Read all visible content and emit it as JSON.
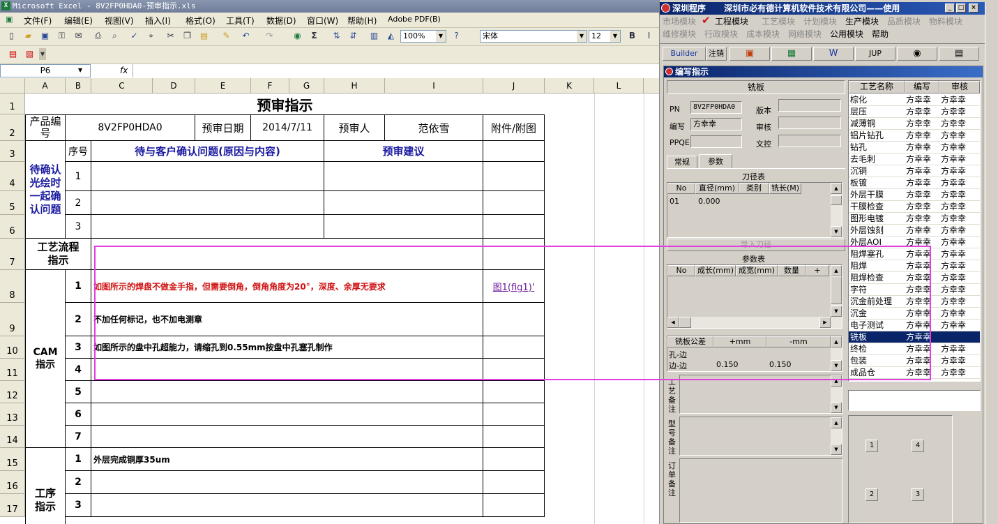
{
  "excel": {
    "title": "Microsoft Excel - 8V2FP0HDA0-预审指示.xls",
    "menu": [
      "文件(F)",
      "编辑(E)",
      "视图(V)",
      "插入(I)",
      "格式(O)",
      "工具(T)",
      "数据(D)",
      "窗口(W)",
      "帮助(H)",
      "Adobe PDF(B)"
    ],
    "zoom": "100%",
    "font_name": "宋体",
    "font_size": "12",
    "bold_label": "B",
    "name_box": "P6",
    "fx_label": "fx",
    "columns": [
      "A",
      "B",
      "C",
      "D",
      "E",
      "F",
      "G",
      "H",
      "I",
      "J",
      "K",
      "L"
    ],
    "rows": [
      "1",
      "2",
      "3",
      "4",
      "5",
      "6",
      "7",
      "8",
      "9",
      "10",
      "11",
      "12",
      "13",
      "14",
      "15",
      "16",
      "17"
    ],
    "sheet": {
      "title": "预审指示",
      "product_label": "产品编号",
      "product_no": "8V2FP0HDA0",
      "date_label": "预审日期",
      "date": "2014/7/11",
      "reviewer_label": "预审人",
      "reviewer": "范依雪",
      "attach_label": "附件/附图",
      "seq_label": "序号",
      "issue_header": "待与客户确认问题(原因与内容)",
      "suggest_header": "预审建议",
      "pending_label": "待确认光绘时一起确认问题",
      "pending_nums": [
        "1",
        "2",
        "3"
      ],
      "flow_label": "工艺流程指示",
      "cam_label": "CAM指示",
      "cam_nums": [
        "1",
        "2",
        "3",
        "4",
        "5",
        "6",
        "7"
      ],
      "cam_items": [
        "如图所示的焊盘不做金手指，但需要倒角，倒角角度为20°，深度、余厚无要求",
        "不加任何标记，也不加电测章",
        "如图所示的盘中孔超能力，请缩孔到0.55mm按盘中孔塞孔制作"
      ],
      "cam_link": "图1(fig1)'",
      "process_label": "工序指示",
      "process_nums": [
        "1",
        "2",
        "3"
      ],
      "process_items": [
        "外层完成铜厚35um"
      ]
    }
  },
  "app": {
    "title": "深圳程序",
    "company": "深圳市必有德计算机软件技术有限公司——使用",
    "win_buttons": [
      "_",
      "□",
      "×"
    ],
    "menu_row1": [
      "市场模块",
      "工程模块",
      "工艺模块",
      "计划模块",
      "生产模块",
      "品质模块",
      "物料模块"
    ],
    "menu_row2": [
      "维修模块",
      "行政模块",
      "成本模块",
      "网络模块",
      "公用模块",
      "帮助"
    ],
    "toolbar": [
      "Builder",
      "注销",
      "JUP"
    ],
    "sub": {
      "title": "编写指示",
      "section": "铣板",
      "pn_label": "PN",
      "pn_value": "8V2FP0HDA0",
      "version_label": "版本",
      "writer_label": "编写",
      "writer_value": "方幸幸",
      "audit_label": "审核",
      "ppqe_label": "PPQE",
      "doc_label": "文控",
      "tabs": [
        "常规",
        "参数"
      ],
      "tool_table_title": "刀径表",
      "tool_cols": [
        "No",
        "直径(mm)",
        "类别",
        "铣长(M)"
      ],
      "tool_rows": [
        [
          "01",
          "0.000",
          "",
          ""
        ]
      ],
      "import_button": "导入刀径",
      "param_title": "参数表",
      "param_cols": [
        "No",
        "成长(mm)",
        "成宽(mm)",
        "数量",
        "+"
      ],
      "tol_cols": [
        "铣板公差",
        "+mm",
        "-mm"
      ],
      "tol_rows": [
        [
          "孔-边",
          "",
          ""
        ],
        [
          "边-边",
          "0.150",
          "0.150"
        ]
      ],
      "note1": "工艺备注",
      "note2": "型号备注",
      "note3": "订单备注",
      "proc_cols": [
        "工艺名称",
        "编写",
        "审核"
      ],
      "processes": [
        [
          "棕化",
          "方幸幸",
          "方幸幸"
        ],
        [
          "层压",
          "方幸幸",
          "方幸幸"
        ],
        [
          "减薄铜",
          "方幸幸",
          "方幸幸"
        ],
        [
          "铝片钻孔",
          "方幸幸",
          "方幸幸"
        ],
        [
          "钻孔",
          "方幸幸",
          "方幸幸"
        ],
        [
          "去毛刺",
          "方幸幸",
          "方幸幸"
        ],
        [
          "沉铜",
          "方幸幸",
          "方幸幸"
        ],
        [
          "板镀",
          "方幸幸",
          "方幸幸"
        ],
        [
          "外层干膜",
          "方幸幸",
          "方幸幸"
        ],
        [
          "干膜检查",
          "方幸幸",
          "方幸幸"
        ],
        [
          "图形电镀",
          "方幸幸",
          "方幸幸"
        ],
        [
          "外层蚀刻",
          "方幸幸",
          "方幸幸"
        ],
        [
          "外层AOI",
          "方幸幸",
          "方幸幸"
        ],
        [
          "阻焊塞孔",
          "方幸幸",
          "方幸幸"
        ],
        [
          "阻焊",
          "方幸幸",
          "方幸幸"
        ],
        [
          "阻焊检查",
          "方幸幸",
          "方幸幸"
        ],
        [
          "字符",
          "方幸幸",
          "方幸幸"
        ],
        [
          "沉金前处理",
          "方幸幸",
          "方幸幸"
        ],
        [
          "沉金",
          "方幸幸",
          "方幸幸"
        ],
        [
          "电子测试",
          "方幸幸",
          "方幸幸"
        ],
        [
          "铣板",
          "方幸幸",
          ""
        ],
        [
          "终检",
          "方幸幸",
          "方幸幸"
        ],
        [
          "包装",
          "方幸幸",
          "方幸幸"
        ],
        [
          "成品仓",
          "方幸幸",
          "方幸幸"
        ]
      ],
      "selected_index": 20,
      "num_buttons": [
        "1",
        "4",
        "2",
        "3"
      ]
    }
  }
}
